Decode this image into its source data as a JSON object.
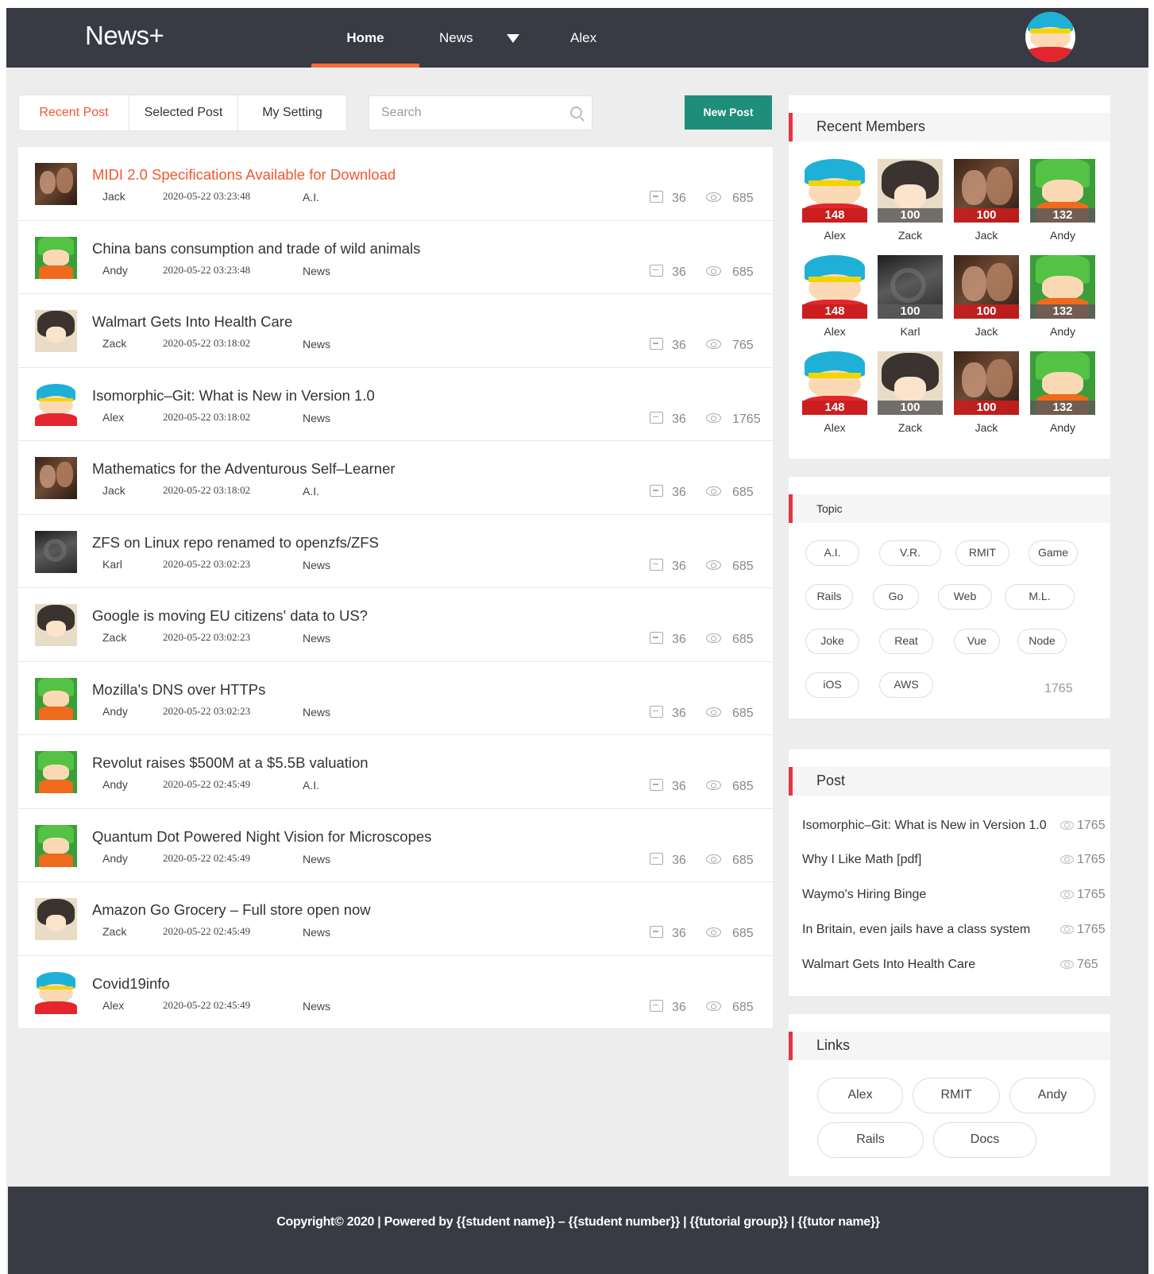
{
  "brand": "News+",
  "nav": {
    "home": "Home",
    "news": "News",
    "user": "Alex"
  },
  "tabs": {
    "recent": "Recent Post",
    "selected": "Selected Post",
    "setting": "My Setting"
  },
  "search": {
    "placeholder": "Search"
  },
  "new_post": "New Post",
  "posts": [
    {
      "title": "MIDI 2.0 Specifications Available for Download",
      "author": "Jack",
      "date": "2020-05-22 03:23:48",
      "category": "A.I.",
      "comments": "36",
      "views": "685"
    },
    {
      "title": "China bans consumption and trade of wild animals",
      "author": "Andy",
      "date": "2020-05-22 03:23:48",
      "category": "News",
      "comments": "36",
      "views": "685"
    },
    {
      "title": "Walmart Gets Into Health Care",
      "author": "Zack",
      "date": "2020-05-22 03:18:02",
      "category": "News",
      "comments": "36",
      "views": "765"
    },
    {
      "title": "Isomorphic–Git: What is New in Version 1.0",
      "author": "Alex",
      "date": "2020-05-22 03:18:02",
      "category": "News",
      "comments": "36",
      "views": "1765"
    },
    {
      "title": "Mathematics for the Adventurous Self–Learner",
      "author": "Jack",
      "date": "2020-05-22 03:18:02",
      "category": "A.I.",
      "comments": "36",
      "views": "685"
    },
    {
      "title": "ZFS on Linux repo renamed to openzfs/ZFS",
      "author": "Karl",
      "date": "2020-05-22 03:02:23",
      "category": "News",
      "comments": "36",
      "views": "685"
    },
    {
      "title": "Google is moving EU citizens' data to US?",
      "author": "Zack",
      "date": "2020-05-22 03:02:23",
      "category": "News",
      "comments": "36",
      "views": "685"
    },
    {
      "title": "Mozilla's DNS over HTTPs",
      "author": "Andy",
      "date": "2020-05-22 03:02:23",
      "category": "News",
      "comments": "36",
      "views": "685"
    },
    {
      "title": "Revolut raises $500M at a $5.5B valuation",
      "author": "Andy",
      "date": "2020-05-22 02:45:49",
      "category": "A.I.",
      "comments": "36",
      "views": "685"
    },
    {
      "title": "Quantum Dot Powered Night Vision for Microscopes",
      "author": "Andy",
      "date": "2020-05-22 02:45:49",
      "category": "News",
      "comments": "36",
      "views": "685"
    },
    {
      "title": "Amazon Go Grocery – Full store open now",
      "author": "Zack",
      "date": "2020-05-22 02:45:49",
      "category": "News",
      "comments": "36",
      "views": "685"
    },
    {
      "title": "Covid19info",
      "author": "Alex",
      "date": "2020-05-22 02:45:49",
      "category": "News",
      "comments": "36",
      "views": "685"
    }
  ],
  "members": {
    "title": "Recent Members",
    "items": [
      {
        "name": "Alex",
        "score": "148"
      },
      {
        "name": "Zack",
        "score": "100"
      },
      {
        "name": "Jack",
        "score": "100"
      },
      {
        "name": "Andy",
        "score": "132"
      },
      {
        "name": "Alex",
        "score": "148"
      },
      {
        "name": "Karl",
        "score": "100"
      },
      {
        "name": "Jack",
        "score": "100"
      },
      {
        "name": "Andy",
        "score": "132"
      },
      {
        "name": "Alex",
        "score": "148"
      },
      {
        "name": "Zack",
        "score": "100"
      },
      {
        "name": "Jack",
        "score": "100"
      },
      {
        "name": "Andy",
        "score": "132"
      }
    ]
  },
  "topics": {
    "title": "Topic",
    "items": [
      "A.I.",
      "V.R.",
      "RMIT",
      "Game",
      "Rails",
      "Go",
      "Web",
      "M.L.",
      "Joke",
      "Reat",
      "Vue",
      "Node",
      "iOS",
      "AWS"
    ],
    "count": "1765"
  },
  "post_panel": {
    "title": "Post",
    "items": [
      {
        "title": "Isomorphic–Git: What is New in Version 1.0",
        "views": "1765"
      },
      {
        "title": "Why I Like Math [pdf]",
        "views": "1765"
      },
      {
        "title": "Waymo's Hiring Binge",
        "views": "1765"
      },
      {
        "title": "In Britain, even jails have a class system",
        "views": "1765"
      },
      {
        "title": "Walmart Gets Into Health Care",
        "views": "765"
      }
    ]
  },
  "links": {
    "title": "Links",
    "items": [
      "Alex",
      "RMIT",
      "Andy",
      "Rails",
      "Docs"
    ]
  },
  "footer": "Copyright© 2020 | Powered by {{student name}} – {{student number}} | {{tutorial group}} | {{tutor name}}",
  "colors": {
    "header_bg": "#383a44",
    "accent": "#f2582e",
    "new_post_bg": "#1e8e7a",
    "panel_marker": "#e53644"
  }
}
